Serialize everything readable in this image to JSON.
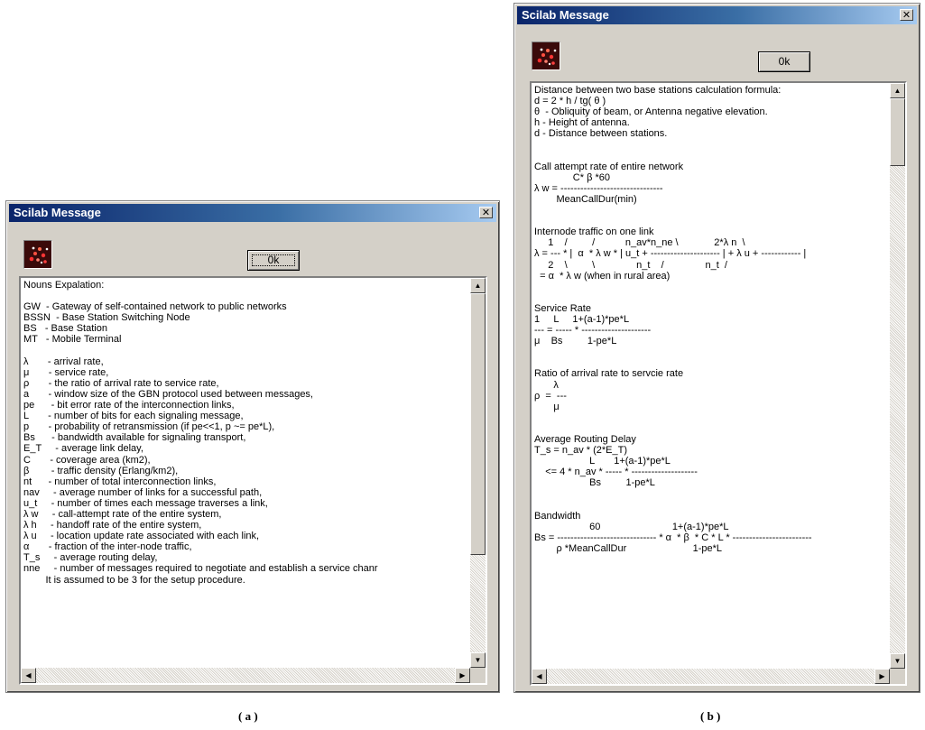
{
  "panel_a": {
    "title": "Scilab Message",
    "close_glyph": "✕",
    "icon": "scilab-icon",
    "ok_label": "0k",
    "lines": [
      "Nouns Expalation:",
      "",
      "GW  - Gateway of self-contained network to public networks",
      "BSSN  - Base Station Switching Node",
      "BS   - Base Station",
      "MT   - Mobile Terminal",
      "",
      "λ       - arrival rate,",
      "μ       - service rate,",
      "ρ       - the ratio of arrival rate to service rate,",
      "a       - window size of the GBN protocol used between messages,",
      "pe      - bit error rate of the interconnection links,",
      "L       - number of bits for each signaling message,",
      "p       - probability of retransmission (if pe<<1, p ~= pe*L),",
      "Bs      - bandwidth available for signaling transport,",
      "E_T     - average link delay,",
      "C       - coverage area (km2),",
      "β        - traffic density (Erlang/km2),",
      "nt      - number of total interconnection links,",
      "nav     - average number of links for a successful path,",
      "u_t     - number of times each message traverses a link,",
      "λ w     - call-attempt rate of the entire system,",
      "λ h     - handoff rate of the entire system,",
      "λ u     - location update rate associated with each link,",
      "α       - fraction of the inter-node traffic,",
      "T_s     - average routing delay,",
      "nne     - number of messages required to negotiate and establish a service chanr",
      "        It is assumed to be 3 for the setup procedure."
    ]
  },
  "panel_b": {
    "title": "Scilab Message",
    "close_glyph": "✕",
    "icon": "scilab-icon",
    "ok_label": "0k",
    "lines": [
      "Distance between two base stations calculation formula:",
      "d = 2 * h / tg( θ )",
      "θ  - Obliquity of beam, or Antenna negative elevation.",
      "h - Height of antenna.",
      "d - Distance between stations.",
      "",
      "",
      "Call attempt rate of entire network",
      "              C* β *60",
      "λ w = -------------------------------",
      "        MeanCallDur(min)",
      "",
      "",
      "Internode traffic on one link",
      "     1    /         /           n_av*n_ne \\             2*λ n  \\",
      "λ = --- * |  α  * λ w * | u_t + --------------------- | + λ u + ------------ |",
      "     2    \\         \\               n_t    /               n_t  /",
      "  = α  * λ w (when in rural area)",
      "",
      "",
      "Service Rate",
      "1     L     1+(a-1)*pe*L",
      "--- = ----- * ---------------------",
      "μ    Bs         1-pe*L",
      "",
      "",
      "Ratio of arrival rate to servcie rate",
      "       λ",
      "ρ  =  ---",
      "       μ",
      "",
      "",
      "Average Routing Delay",
      "T_s = n_av * (2*E_T)",
      "                    L       1+(a-1)*pe*L",
      "    <= 4 * n_av * ----- * --------------------",
      "                    Bs         1-pe*L",
      "",
      "",
      "Bandwidth",
      "                    60                          1+(a-1)*pe*L",
      "Bs = ------------------------------ * α  * β  * C * L * ------------------------",
      "        ρ *MeanCallDur                        1-pe*L"
    ]
  },
  "captions": {
    "a": "( a )",
    "b": "( b )"
  }
}
